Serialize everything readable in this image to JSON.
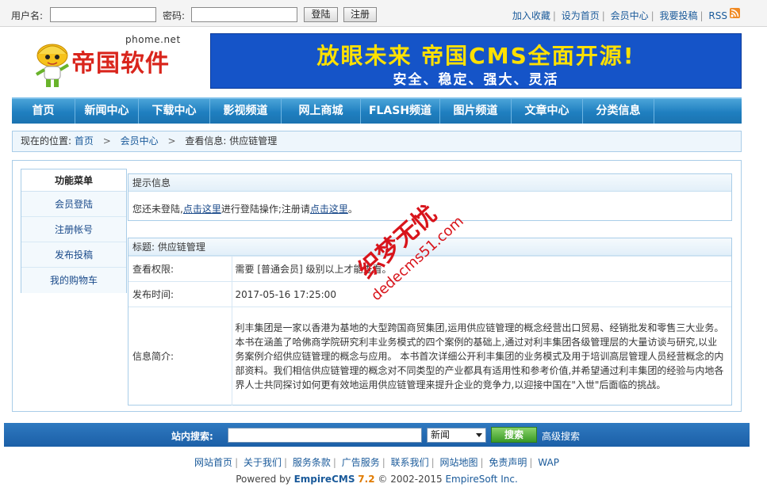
{
  "topbar": {
    "username_label": "用户名:",
    "password_label": "密码:",
    "login_button": "登陆",
    "register_button": "注册",
    "links": [
      "加入收藏",
      "设为首页",
      "会员中心",
      "我要投稿",
      "RSS"
    ]
  },
  "header": {
    "logo_text": "帝国软件",
    "logo_url_text": "phome.net",
    "banner_title": "放眼未来 帝国CMS全面开源!",
    "banner_subtitle": "安全、稳定、强大、灵活"
  },
  "nav": {
    "items": [
      "首页",
      "新闻中心",
      "下载中心",
      "影视频道",
      "网上商城",
      "FLASH频道",
      "图片频道",
      "文章中心",
      "分类信息"
    ]
  },
  "breadcrumb": {
    "prefix": "现在的位置:",
    "home": "首页",
    "member": "会员中心",
    "current": "查看信息: 供应链管理"
  },
  "menu": {
    "title": "功能菜单",
    "items": [
      "会员登陆",
      "注册帐号",
      "发布投稿",
      "我的购物车"
    ]
  },
  "notice": {
    "title": "提示信息",
    "text_1": "您还未登陆,",
    "link_1": "点击这里",
    "text_2": "进行登陆操作;注册请",
    "link_2": "点击这里",
    "text_3": "。"
  },
  "info": {
    "title": "标题: 供应链管理",
    "rows": [
      {
        "key": "查看权限:",
        "value": "需要 [普通会员] 级别以上才能查看。"
      },
      {
        "key": "发布时间:",
        "value": "2017-05-16 17:25:00"
      },
      {
        "key": "信息简介:",
        "value": "利丰集团是一家以香港为基地的大型跨国商贸集团,运用供应链管理的概念经营出口贸易、经销批发和零售三大业务。本书在涵盖了哈佛商学院研究利丰业务模式的四个案例的基础上,通过对利丰集团各级管理层的大量访谈与研究,以业务案例介绍供应链管理的概念与应用。      本书首次详细公开利丰集团的业务模式及用于培训高层管理人员经营概念的内部资料。我们相信供应链管理的概念对不同类型的产业都具有适用性和参考价值,并希望通过利丰集团的经验与内地各界人士共同探讨如何更有效地运用供应链管理来提升企业的竞争力,以迎接中国在\"入世\"后面临的挑战。"
      }
    ]
  },
  "search": {
    "label": "站内搜索:",
    "input_value": "",
    "select_value": "新闻",
    "button": "搜索",
    "advanced": "高级搜索"
  },
  "footer": {
    "links": [
      "网站首页",
      "关于我们",
      "服务条款",
      "广告服务",
      "联系我们",
      "网站地图",
      "免责声明",
      "WAP"
    ],
    "powered_prefix": "Powered by ",
    "brand": "EmpireCMS",
    "version": "7.2",
    "copyright": "© 2002-2015 ",
    "company": "EmpireSoft Inc."
  },
  "watermark": {
    "line1": "织梦无忧",
    "line2": "dedecms51.com"
  },
  "colors": {
    "nav_blue": "#1f7fc0",
    "banner_blue": "#1554c8",
    "banner_yellow": "#ffe100",
    "logo_red": "#d9251c",
    "watermark_red": "#d8141b"
  }
}
